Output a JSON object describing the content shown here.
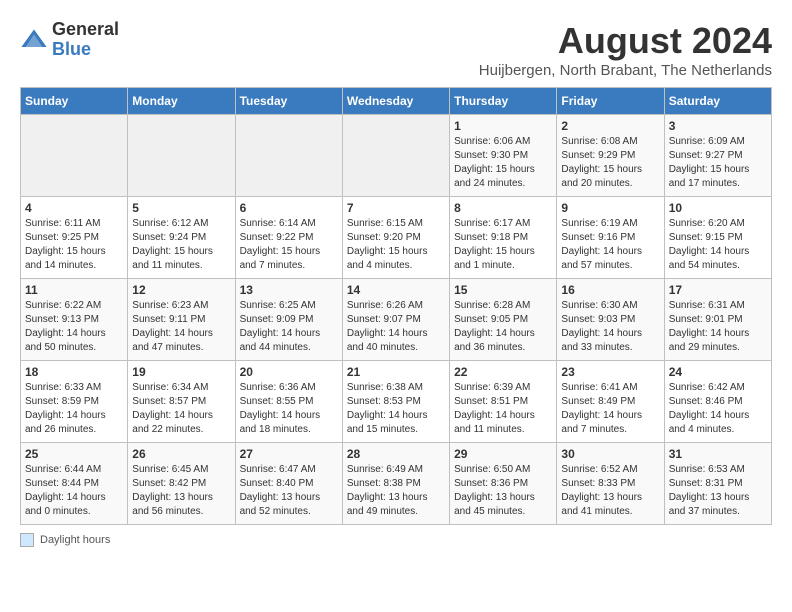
{
  "logo": {
    "general": "General",
    "blue": "Blue"
  },
  "title": "August 2024",
  "subtitle": "Huijbergen, North Brabant, The Netherlands",
  "days_of_week": [
    "Sunday",
    "Monday",
    "Tuesday",
    "Wednesday",
    "Thursday",
    "Friday",
    "Saturday"
  ],
  "footer_label": "Daylight hours",
  "weeks": [
    [
      {
        "day": "",
        "info": ""
      },
      {
        "day": "",
        "info": ""
      },
      {
        "day": "",
        "info": ""
      },
      {
        "day": "",
        "info": ""
      },
      {
        "day": "1",
        "info": "Sunrise: 6:06 AM\nSunset: 9:30 PM\nDaylight: 15 hours\nand 24 minutes."
      },
      {
        "day": "2",
        "info": "Sunrise: 6:08 AM\nSunset: 9:29 PM\nDaylight: 15 hours\nand 20 minutes."
      },
      {
        "day": "3",
        "info": "Sunrise: 6:09 AM\nSunset: 9:27 PM\nDaylight: 15 hours\nand 17 minutes."
      }
    ],
    [
      {
        "day": "4",
        "info": "Sunrise: 6:11 AM\nSunset: 9:25 PM\nDaylight: 15 hours\nand 14 minutes."
      },
      {
        "day": "5",
        "info": "Sunrise: 6:12 AM\nSunset: 9:24 PM\nDaylight: 15 hours\nand 11 minutes."
      },
      {
        "day": "6",
        "info": "Sunrise: 6:14 AM\nSunset: 9:22 PM\nDaylight: 15 hours\nand 7 minutes."
      },
      {
        "day": "7",
        "info": "Sunrise: 6:15 AM\nSunset: 9:20 PM\nDaylight: 15 hours\nand 4 minutes."
      },
      {
        "day": "8",
        "info": "Sunrise: 6:17 AM\nSunset: 9:18 PM\nDaylight: 15 hours\nand 1 minute."
      },
      {
        "day": "9",
        "info": "Sunrise: 6:19 AM\nSunset: 9:16 PM\nDaylight: 14 hours\nand 57 minutes."
      },
      {
        "day": "10",
        "info": "Sunrise: 6:20 AM\nSunset: 9:15 PM\nDaylight: 14 hours\nand 54 minutes."
      }
    ],
    [
      {
        "day": "11",
        "info": "Sunrise: 6:22 AM\nSunset: 9:13 PM\nDaylight: 14 hours\nand 50 minutes."
      },
      {
        "day": "12",
        "info": "Sunrise: 6:23 AM\nSunset: 9:11 PM\nDaylight: 14 hours\nand 47 minutes."
      },
      {
        "day": "13",
        "info": "Sunrise: 6:25 AM\nSunset: 9:09 PM\nDaylight: 14 hours\nand 44 minutes."
      },
      {
        "day": "14",
        "info": "Sunrise: 6:26 AM\nSunset: 9:07 PM\nDaylight: 14 hours\nand 40 minutes."
      },
      {
        "day": "15",
        "info": "Sunrise: 6:28 AM\nSunset: 9:05 PM\nDaylight: 14 hours\nand 36 minutes."
      },
      {
        "day": "16",
        "info": "Sunrise: 6:30 AM\nSunset: 9:03 PM\nDaylight: 14 hours\nand 33 minutes."
      },
      {
        "day": "17",
        "info": "Sunrise: 6:31 AM\nSunset: 9:01 PM\nDaylight: 14 hours\nand 29 minutes."
      }
    ],
    [
      {
        "day": "18",
        "info": "Sunrise: 6:33 AM\nSunset: 8:59 PM\nDaylight: 14 hours\nand 26 minutes."
      },
      {
        "day": "19",
        "info": "Sunrise: 6:34 AM\nSunset: 8:57 PM\nDaylight: 14 hours\nand 22 minutes."
      },
      {
        "day": "20",
        "info": "Sunrise: 6:36 AM\nSunset: 8:55 PM\nDaylight: 14 hours\nand 18 minutes."
      },
      {
        "day": "21",
        "info": "Sunrise: 6:38 AM\nSunset: 8:53 PM\nDaylight: 14 hours\nand 15 minutes."
      },
      {
        "day": "22",
        "info": "Sunrise: 6:39 AM\nSunset: 8:51 PM\nDaylight: 14 hours\nand 11 minutes."
      },
      {
        "day": "23",
        "info": "Sunrise: 6:41 AM\nSunset: 8:49 PM\nDaylight: 14 hours\nand 7 minutes."
      },
      {
        "day": "24",
        "info": "Sunrise: 6:42 AM\nSunset: 8:46 PM\nDaylight: 14 hours\nand 4 minutes."
      }
    ],
    [
      {
        "day": "25",
        "info": "Sunrise: 6:44 AM\nSunset: 8:44 PM\nDaylight: 14 hours\nand 0 minutes."
      },
      {
        "day": "26",
        "info": "Sunrise: 6:45 AM\nSunset: 8:42 PM\nDaylight: 13 hours\nand 56 minutes."
      },
      {
        "day": "27",
        "info": "Sunrise: 6:47 AM\nSunset: 8:40 PM\nDaylight: 13 hours\nand 52 minutes."
      },
      {
        "day": "28",
        "info": "Sunrise: 6:49 AM\nSunset: 8:38 PM\nDaylight: 13 hours\nand 49 minutes."
      },
      {
        "day": "29",
        "info": "Sunrise: 6:50 AM\nSunset: 8:36 PM\nDaylight: 13 hours\nand 45 minutes."
      },
      {
        "day": "30",
        "info": "Sunrise: 6:52 AM\nSunset: 8:33 PM\nDaylight: 13 hours\nand 41 minutes."
      },
      {
        "day": "31",
        "info": "Sunrise: 6:53 AM\nSunset: 8:31 PM\nDaylight: 13 hours\nand 37 minutes."
      }
    ]
  ]
}
